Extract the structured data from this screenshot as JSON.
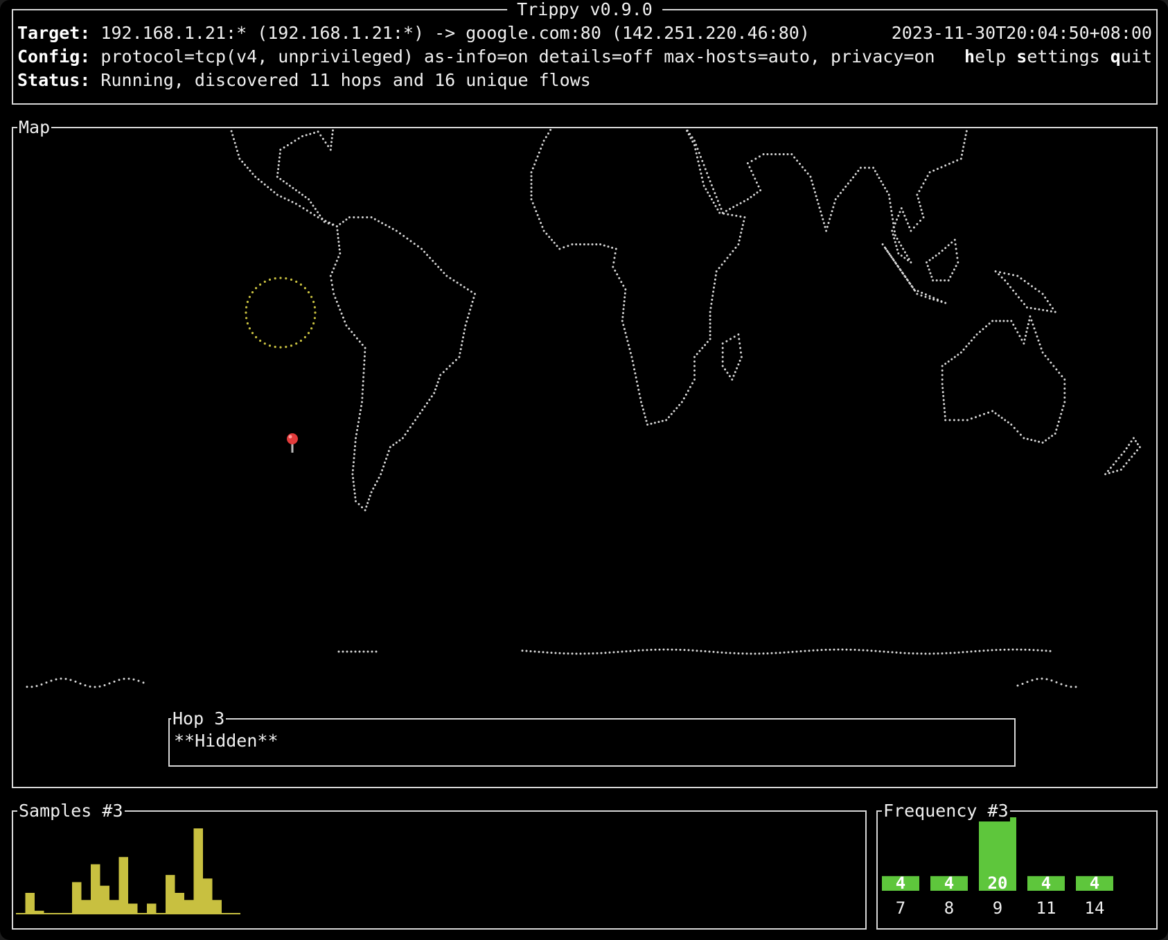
{
  "app": {
    "title": "Trippy v0.9.0"
  },
  "header": {
    "target_label": "Target:",
    "target_value": "192.168.1.21:* (192.168.1.21:*) -> google.com:80 (142.251.220.46:80)",
    "config_label": "Config:",
    "config_value": "protocol=tcp(v4, unprivileged) as-info=on details=off max-hosts=auto, privacy=on",
    "status_label": "Status:",
    "status_value": "Running, discovered 11 hops and 16 unique flows",
    "timestamp": "2023-11-30T20:04:50+08:00",
    "menu": [
      {
        "key": "h",
        "rest": "elp"
      },
      {
        "key": "s",
        "rest": "ettings"
      },
      {
        "key": "q",
        "rest": "uit"
      }
    ]
  },
  "map": {
    "title": "Map",
    "pin_icon": "map-pin-icon",
    "coverage_color": "#c8c040",
    "dot_color": "#d8d8d8"
  },
  "hop": {
    "title": "Hop 3",
    "details": "**Hidden**"
  },
  "samples": {
    "title": "Samples #3",
    "bar_color": "#c8c040",
    "values": [
      0,
      6,
      1,
      0,
      0,
      0,
      9,
      4,
      14,
      8,
      4,
      16,
      3,
      0,
      3,
      0,
      11,
      6,
      4,
      24,
      10,
      4,
      0,
      0
    ]
  },
  "frequency": {
    "title": "Frequency #3",
    "bar_color": "#5ec63c",
    "bars": [
      {
        "label": "7",
        "value": "4",
        "count": 4
      },
      {
        "label": "8",
        "value": "4",
        "count": 4
      },
      {
        "label": "9",
        "value": "20",
        "count": 20
      },
      {
        "label": "11",
        "value": "4",
        "count": 4
      },
      {
        "label": "14",
        "value": "4",
        "count": 4
      }
    ]
  }
}
